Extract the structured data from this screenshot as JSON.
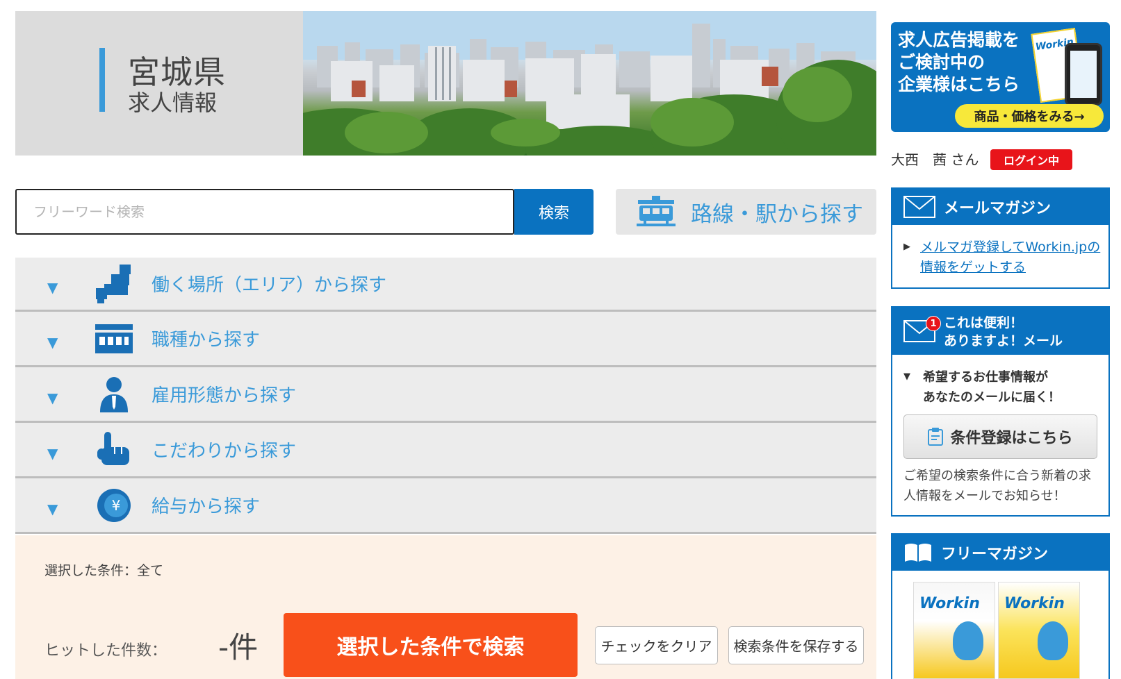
{
  "header": {
    "pref_name": "宮城県",
    "pref_sub": "求人情報",
    "colors": {
      "accent": "#3a9ad9",
      "brand_blue": "#0a72c0"
    }
  },
  "search": {
    "placeholder": "フリーワード検索",
    "button_label": "検索",
    "station_label": "路線・駅から探す",
    "station_icon": "train-icon"
  },
  "accordion": {
    "items": [
      {
        "label": "働く場所（エリア）から探す",
        "icon": "map-area-icon"
      },
      {
        "label": "職種から探す",
        "icon": "shop-icon"
      },
      {
        "label": "雇用形態から探す",
        "icon": "person-icon"
      },
      {
        "label": "こだわりから探す",
        "icon": "pointing-hand-icon"
      },
      {
        "label": "給与から探す",
        "icon": "yen-coin-icon"
      }
    ]
  },
  "result": {
    "selected_conditions": "選択した条件：全て",
    "hit_label": "ヒットした件数：",
    "hit_count": "-件",
    "search_button": "選択した条件で検索",
    "clear_button": "チェックをクリア",
    "save_button": "検索条件を保存する",
    "colors": {
      "search_button_bg": "#f8501a",
      "panel_bg": "#fdf1e6"
    }
  },
  "sidebar": {
    "ad": {
      "line1": "求人広告掲載を",
      "line2": "ご検討中の",
      "line3": "企業様はこちら",
      "cta": "商品・価格をみる→",
      "magazine_logo": "Workin"
    },
    "user": {
      "name": "大西　茜 さん",
      "status": "ログイン中"
    },
    "mail_magazine": {
      "title": "メールマガジン",
      "link": "メルマガ登録してWorkin.jpの情報をゲットする"
    },
    "job_alert": {
      "badge": "1",
      "title_line1": "これは便利！",
      "title_line2": "ありますよ！メール",
      "desc_line1": "希望するお仕事情報が",
      "desc_line2": "あなたのメールに届く！",
      "button": "条件登録はこちら",
      "note": "ご希望の検索条件に合う新着の求人情報をメールでお知らせ！"
    },
    "free_magazine": {
      "title": "フリーマガジン",
      "cover_logo": "Workin"
    }
  }
}
